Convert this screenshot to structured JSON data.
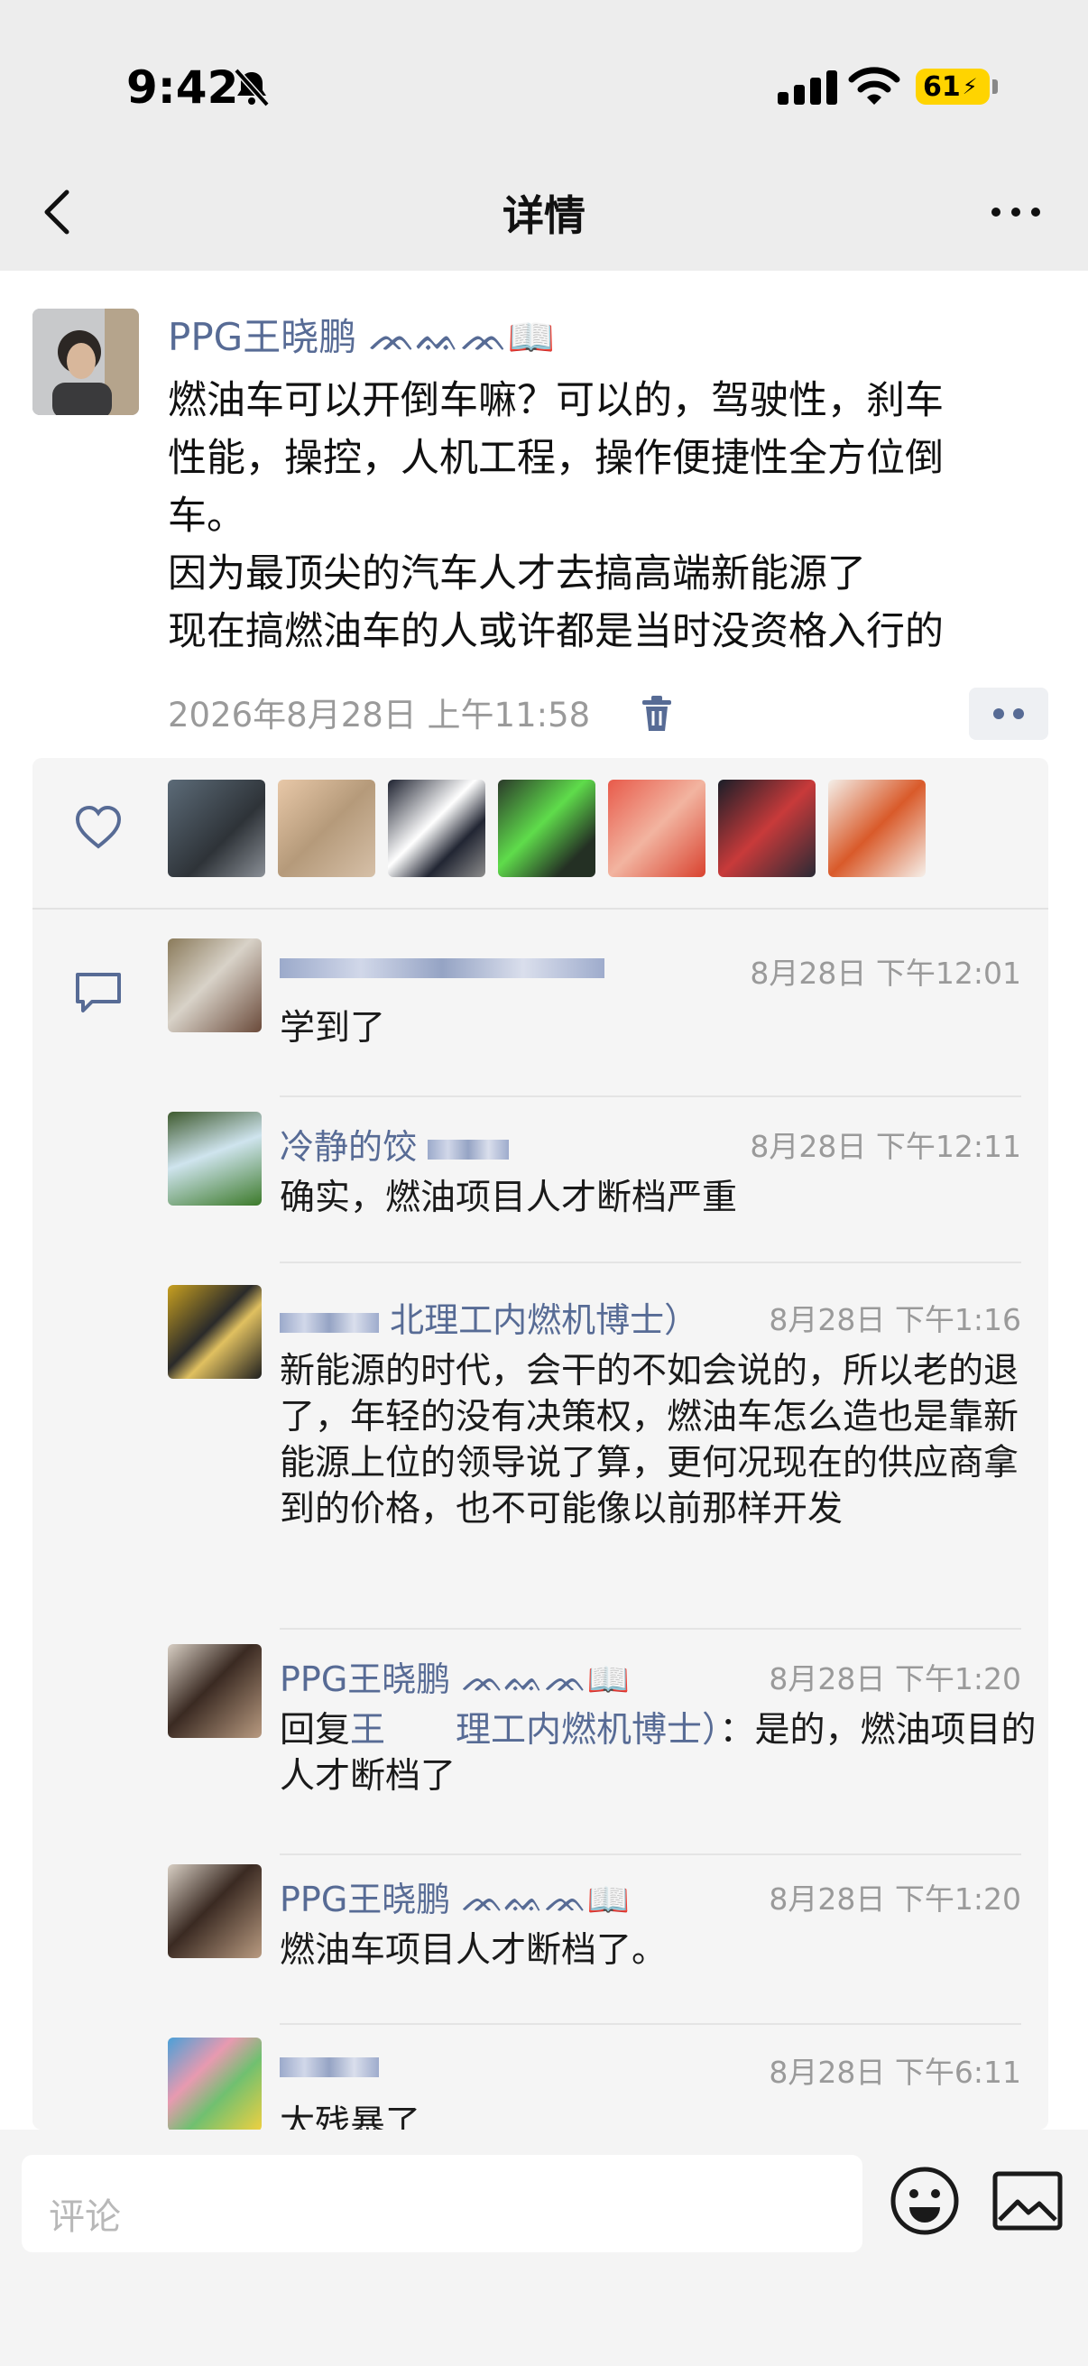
{
  "status_bar": {
    "time": "9:42",
    "battery": "61",
    "icons": [
      "bell-slash-icon",
      "cellular-signal-icon",
      "wifi-icon",
      "battery-charging-icon"
    ]
  },
  "nav": {
    "title": "详情",
    "back_icon": "chevron-left-icon",
    "more_icon": "ellipsis-icon"
  },
  "post": {
    "author": "PPG王晓鹏 ᚝᚝᚝ 📖",
    "author_display": "PPG王晓鹏 ᨏᨐᨏ📖",
    "text_lines": [
      "燃油车可以开倒车嘛？可以的，驾驶性，刹车",
      "性能，操控，人机工程，操作便捷性全方位倒",
      "车。",
      "因为最顶尖的汽车人才去搞高端新能源了",
      "现在搞燃油车的人或许都是当时没资格入行的"
    ],
    "timestamp": "2026年8月28日 上午11:58"
  },
  "likes": {
    "count_avatars": 7
  },
  "comments": [
    {
      "name": "",
      "time": "8月28日 下午12:01",
      "text": "学到了"
    },
    {
      "name": "冷静的饺",
      "time": "8月28日 下午12:11",
      "text": "确实，燃油项目人才断档严重"
    },
    {
      "name": "北理工内燃机博士）",
      "time": "8月28日 下午1:16",
      "text": "新能源的时代，会干的不如会说的，所以老的退了，年轻的没有决策权，燃油车怎么造也是靠新能源上位的领导说了算，更何况现在的供应商拿到的价格，也不可能像以前那样开发"
    },
    {
      "name": "PPG王晓鹏 ᨏᨐᨏ📖",
      "time": "8月28日 下午1:20",
      "reply_prefix": "回复",
      "reply_to": "王　　理工内燃机博士）",
      "text": "：是的，燃油项目的人才断档了"
    },
    {
      "name": "PPG王晓鹏 ᨏᨐᨏ📖",
      "time": "8月28日 下午1:20",
      "text": "燃油车项目人才断档了。"
    },
    {
      "name": "",
      "time": "8月28日 下午6:11",
      "text": "太残暴了"
    }
  ],
  "input": {
    "placeholder": "评论"
  },
  "colors": {
    "link_blue": "#576b95",
    "bar_bg": "#ededed",
    "panel_bg": "#f5f5f5",
    "battery_yellow": "#ffd400"
  }
}
